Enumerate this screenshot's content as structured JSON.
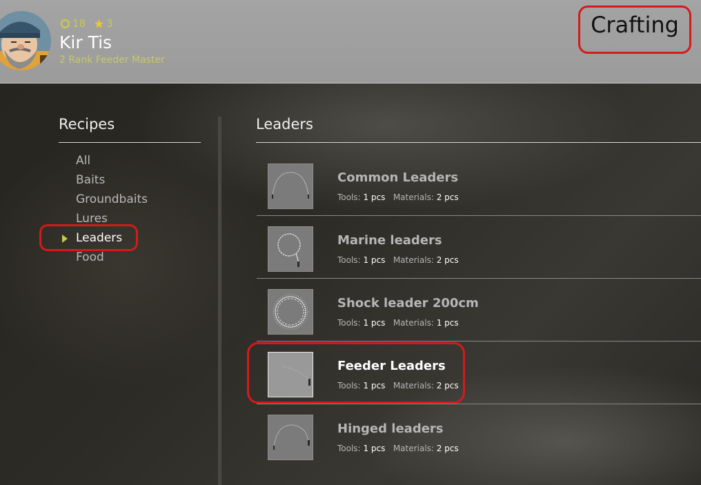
{
  "player": {
    "coins": "18",
    "stars": "3",
    "name": "Kir Tis",
    "rank": "2 Rank Feeder Master",
    "coin_color": "#c8c850",
    "star_color": "#e6c832"
  },
  "screen_title": "Crafting",
  "recipes_panel": {
    "heading": "Recipes",
    "items": [
      {
        "label": "All",
        "active": false
      },
      {
        "label": "Baits",
        "active": false
      },
      {
        "label": "Groundbaits",
        "active": false
      },
      {
        "label": "Lures",
        "active": false
      },
      {
        "label": "Leaders",
        "active": true
      },
      {
        "label": "Food",
        "active": false
      }
    ]
  },
  "category": {
    "heading": "Leaders",
    "tools_label": "Tools:",
    "materials_label": "Materials:",
    "items": [
      {
        "name": "Common Leaders",
        "tools": "1 pcs",
        "materials": "2 pcs",
        "icon": "common-leader-icon",
        "selected": false
      },
      {
        "name": "Marine leaders",
        "tools": "1 pcs",
        "materials": "2 pcs",
        "icon": "marine-leader-icon",
        "selected": false
      },
      {
        "name": "Shock leader 200cm",
        "tools": "1 pcs",
        "materials": "1 pcs",
        "icon": "shock-leader-icon",
        "selected": false
      },
      {
        "name": "Feeder Leaders",
        "tools": "1 pcs",
        "materials": "2 pcs",
        "icon": "feeder-leader-icon",
        "selected": true
      },
      {
        "name": "Hinged leaders",
        "tools": "1 pcs",
        "materials": "2 pcs",
        "icon": "hinged-leader-icon",
        "selected": false
      }
    ]
  },
  "highlight_color": "#d51a1a"
}
